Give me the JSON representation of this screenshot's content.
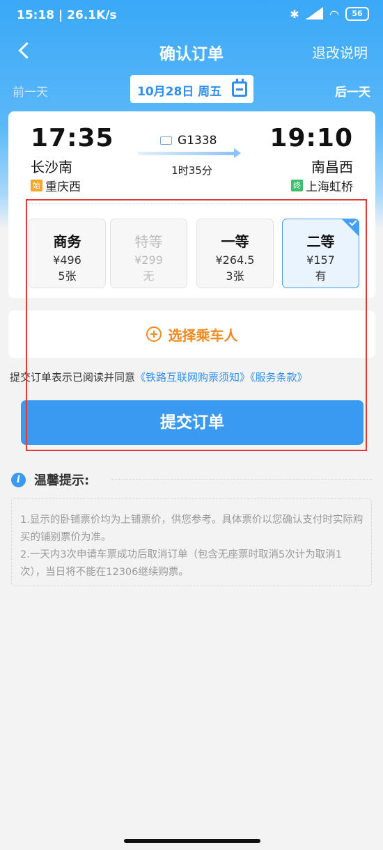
{
  "status_bar": {
    "time": "15:18",
    "speed": "26.1K/s",
    "battery": "56"
  },
  "nav": {
    "title": "确认订单",
    "refund_label": "退改说明",
    "back_icon": "chevron-left-icon"
  },
  "date_bar": {
    "prev_label": "前一天",
    "next_label": "后一天",
    "date": "10月28日 周五"
  },
  "train": {
    "number": "G1338",
    "duration": "1时35分",
    "depart_time": "17:35",
    "depart_station": "长沙南",
    "arrive_time": "19:10",
    "arrive_station": "南昌西",
    "origin_tag": "始",
    "origin": "重庆西",
    "terminal_tag": "终",
    "terminal": "上海虹桥"
  },
  "seats": [
    {
      "name": "商务",
      "price": "¥496",
      "count": "5张",
      "available": true,
      "selected": false
    },
    {
      "name": "特等",
      "price": "¥299",
      "count": "无",
      "available": false,
      "selected": false
    },
    {
      "name": "一等",
      "price": "¥264.5",
      "count": "3张",
      "available": true,
      "selected": false
    },
    {
      "name": "二等",
      "price": "¥157",
      "count": "有",
      "available": true,
      "selected": true
    }
  ],
  "passenger": {
    "label": "选择乘车人"
  },
  "agreement": {
    "prefix": "提交订单表示已阅读并同意",
    "link1": "《铁路互联网购票须知》",
    "link2": "《服务条款》"
  },
  "submit_label": "提交订单",
  "tips": {
    "title": "温馨提示:",
    "items": [
      "1.显示的卧铺票价均为上铺票价，供您参考。具体票价以您确认支付时实际购买的铺别票价为准。",
      "2.一天内3次申请车票成功后取消订单（包含无座票时取消5次计为取消1次），当日将不能在12306继续购票。"
    ]
  },
  "colors": {
    "brand_blue": "#3a9af1",
    "accent_orange": "#f28a1e",
    "highlight_red": "#e53935"
  }
}
